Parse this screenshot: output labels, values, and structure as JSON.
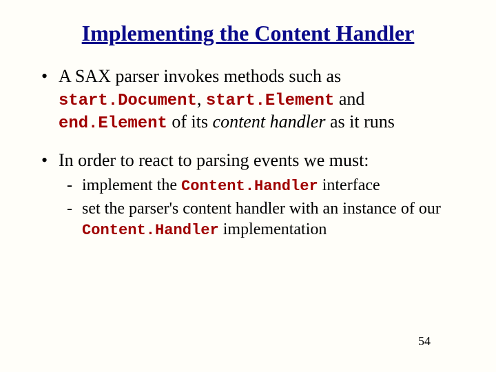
{
  "title": "Implementing the Content Handler",
  "bullets": [
    {
      "pre": "A SAX parser invokes methods such as ",
      "code1": "start.Document",
      "mid1": ", ",
      "code2": "start.Element",
      "mid2": " and ",
      "code3": "end.Element",
      "mid3": " of its ",
      "ital": "content handler",
      "post": " as it runs"
    },
    {
      "text": "In order to react to parsing events we must:",
      "sub": [
        {
          "pre": "implement the ",
          "code": "Content.Handler",
          "post": " interface"
        },
        {
          "pre": "set the parser's content handler with an instance of our ",
          "code": "Content.Handler",
          "post": " implementation"
        }
      ]
    }
  ],
  "page": "54"
}
